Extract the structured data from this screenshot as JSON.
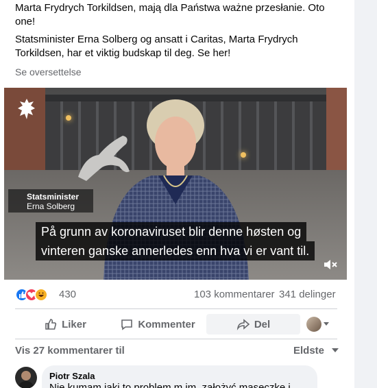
{
  "post": {
    "text_polish_tail": "Marta Frydrych Torkildsen, mają dla Państwa ważne przesłanie. Oto one!",
    "text_norwegian": "Statsminister Erna Solberg og ansatt i Caritas, Marta Frydrych Torkildsen, har et viktig budskap til deg. Se her!",
    "see_translation": "Se oversettelse"
  },
  "video": {
    "lower_third_title": "Statsminister",
    "lower_third_name": "Erna Solberg",
    "subtitle_line1": "På grunn av koronaviruset blir denne høsten og",
    "subtitle_line2": "vinteren ganske annerledes enn hva vi er vant til.",
    "logo_icon": "norwegian-lion-crest-icon",
    "mute_icon": "speaker-muted-icon"
  },
  "stats": {
    "reactions_count": "430",
    "reaction_icons": [
      "like-icon",
      "love-icon",
      "haha-icon"
    ],
    "comments": "103 kommentarer",
    "shares": "341 delinger"
  },
  "actions": {
    "like": "Liker",
    "comment": "Kommenter",
    "share": "Del"
  },
  "comments": {
    "view_more": "Vis 27 kommentarer til",
    "sort": "Eldste",
    "first": {
      "author": "Piotr Szala",
      "text": "Nie kumam jaki to problem m im, założyć maseczkę i"
    }
  },
  "colors": {
    "like_blue": "#1877f2",
    "love_red": "#f33e58",
    "haha_yellow": "#f7b125",
    "muted_text": "#65676b"
  }
}
